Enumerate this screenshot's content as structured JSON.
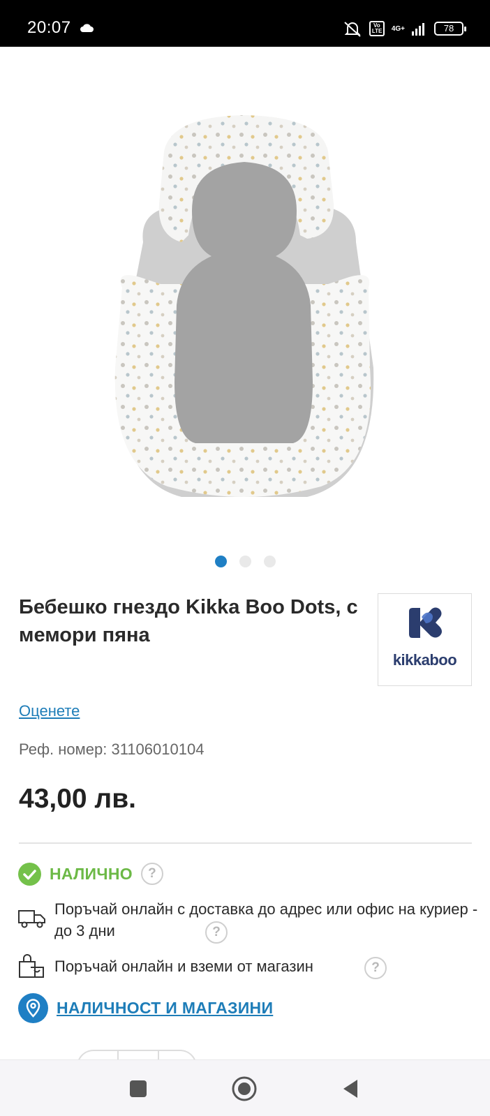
{
  "status_bar": {
    "time": "20:07",
    "network": "4G+",
    "volte": "Vo LTE",
    "battery": "78",
    "icons": [
      "cloud-icon",
      "mute-icon",
      "volte-icon",
      "signal-icon",
      "battery-icon"
    ]
  },
  "carousel": {
    "count": 3,
    "active_index": 0
  },
  "product": {
    "title": "Бебешко гнездо Kikka Boo Dots, с мемори пяна",
    "brand_logo_text": "kikkaboo",
    "rate_link": "Оценете",
    "ref": "Реф. номер: 31106010104",
    "price": "43,00 лв."
  },
  "availability": {
    "stock_status": "НАЛИЧНО",
    "help_glyph": "?",
    "delivery": "Поръчай онлайн с доставка до адрес или офис на куриер - до 3 дни",
    "pickup": "Поръчай онлайн и вземи от магазин",
    "stores_link": "НАЛИЧНОСТ И МАГАЗИНИ"
  },
  "colors": {
    "accent_blue": "#1f7fc4",
    "stock_green": "#6cb946",
    "brand_navy": "#2b3d6e"
  },
  "nav_bar": {
    "icons": [
      "recents-square-icon",
      "home-circle-icon",
      "back-triangle-icon"
    ]
  }
}
